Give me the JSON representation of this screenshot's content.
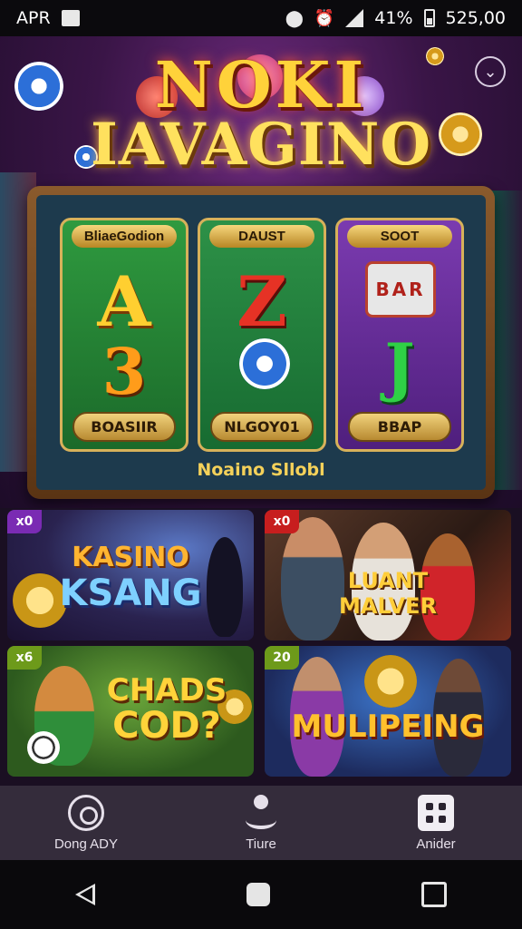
{
  "status_bar": {
    "left_text": "APR",
    "battery": "41%",
    "time": "525,00"
  },
  "header": {
    "logo_top": "NOKI",
    "logo_bottom": "IAVAGINO"
  },
  "slot_machine": {
    "reels": [
      {
        "label": "BliaeGodion",
        "symbol_top": "A",
        "symbol_bottom": "3",
        "button": "BOASIIR"
      },
      {
        "label": "DAUST",
        "symbol_top": "Z",
        "symbol_bottom": "",
        "button": "NLGOY01"
      },
      {
        "label": "SOOT",
        "symbol_top": "",
        "symbol_bottom": "J",
        "button": "BBAP",
        "mini_reel": "BAR"
      }
    ],
    "caption": "Noaino Sllobl"
  },
  "tiles": [
    {
      "badge": "x0",
      "title_line1": "KASINO",
      "title_line2": "KSANG",
      "badge_color": "#7a2bb3"
    },
    {
      "badge": "x0",
      "title_line1": "LUANT",
      "title_line2": "MALVER",
      "badge_color": "#c71e1e"
    },
    {
      "badge": "x6",
      "title_line1": "CHADS",
      "title_line2": "COD?",
      "badge_color": "#6d9a1a"
    },
    {
      "badge": "20",
      "title_line1": "MULIPEING",
      "title_line2": "",
      "badge_color": "#6d9a1a"
    }
  ],
  "bottom_nav": [
    {
      "label": "Dong ADY",
      "icon": "home-circle-icon"
    },
    {
      "label": "Tiure",
      "icon": "person-icon"
    },
    {
      "label": "Anider",
      "icon": "grid-icon"
    }
  ],
  "colors": {
    "accent_gold": "#f5d15a",
    "nav_bg": "#342c3b",
    "hero_purple": "#6d2a7d"
  }
}
